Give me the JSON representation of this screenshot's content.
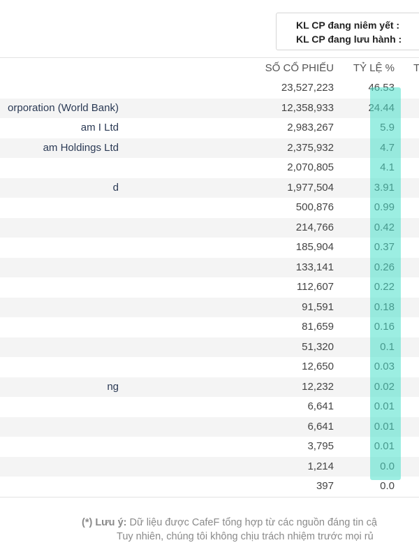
{
  "info_box": {
    "listed_label": "KL CP đang niêm yết :",
    "outstanding_label": "KL CP đang lưu hành :"
  },
  "table": {
    "headers": {
      "shares": "SỐ CỔ PHIẾU",
      "ratio": "TỶ LỆ %",
      "extra": "T"
    },
    "rows": [
      {
        "name": "",
        "shares": "23,527,223",
        "ratio": "46.53"
      },
      {
        "name": "orporation (World Bank)",
        "shares": "12,358,933",
        "ratio": "24.44"
      },
      {
        "name": "am I Ltd",
        "shares": "2,983,267",
        "ratio": "5.9"
      },
      {
        "name": "am Holdings Ltd",
        "shares": "2,375,932",
        "ratio": "4.7"
      },
      {
        "name": "",
        "shares": "2,070,805",
        "ratio": "4.1"
      },
      {
        "name": "d",
        "shares": "1,977,504",
        "ratio": "3.91"
      },
      {
        "name": "",
        "shares": "500,876",
        "ratio": "0.99"
      },
      {
        "name": "",
        "shares": "214,766",
        "ratio": "0.42"
      },
      {
        "name": "",
        "shares": "185,904",
        "ratio": "0.37"
      },
      {
        "name": "",
        "shares": "133,141",
        "ratio": "0.26"
      },
      {
        "name": "",
        "shares": "112,607",
        "ratio": "0.22"
      },
      {
        "name": "",
        "shares": "91,591",
        "ratio": "0.18"
      },
      {
        "name": "",
        "shares": "81,659",
        "ratio": "0.16"
      },
      {
        "name": "",
        "shares": "51,320",
        "ratio": "0.1"
      },
      {
        "name": "",
        "shares": "12,650",
        "ratio": "0.03"
      },
      {
        "name": "ng",
        "shares": "12,232",
        "ratio": "0.02"
      },
      {
        "name": "",
        "shares": "6,641",
        "ratio": "0.01"
      },
      {
        "name": "",
        "shares": "6,641",
        "ratio": "0.01"
      },
      {
        "name": "",
        "shares": "3,795",
        "ratio": "0.01"
      },
      {
        "name": "",
        "shares": "1,214",
        "ratio": "0.0"
      },
      {
        "name": "",
        "shares": "397",
        "ratio": "0.0"
      }
    ]
  },
  "note": {
    "title": "(*) Lưu ý:",
    "line1": " Dữ liệu được CafeF tổng hợp từ các nguồn đáng tin cậ",
    "line2": "Tuy nhiên, chúng tôi không chịu trách nhiệm trước mọi rủ"
  },
  "colors": {
    "highlight": "#4ae0cb",
    "alt_row": "#f4f4f4",
    "name_text": "#2b3a55"
  }
}
